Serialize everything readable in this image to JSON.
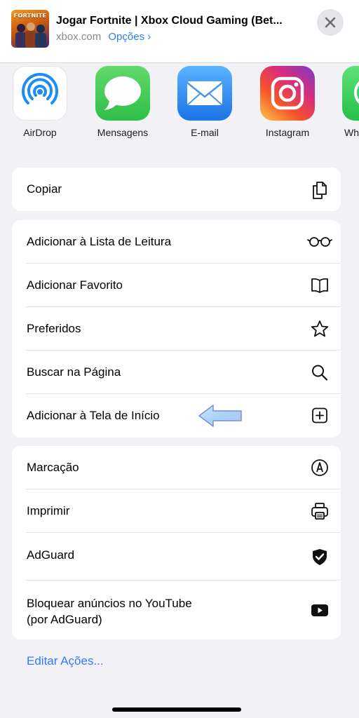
{
  "header": {
    "thumbnail_text": "FORTNITE",
    "title": "Jogar Fortnite | Xbox Cloud Gaming (Bet...",
    "domain": "xbox.com",
    "options_label": "Opções",
    "options_chevron": "›",
    "close_icon": "close-icon"
  },
  "apps": [
    {
      "label": "AirDrop",
      "icon": "airdrop-icon"
    },
    {
      "label": "Mensagens",
      "icon": "messages-icon"
    },
    {
      "label": "E-mail",
      "icon": "mail-icon"
    },
    {
      "label": "Instagram",
      "icon": "instagram-icon"
    },
    {
      "label": "Wh",
      "icon": "whatsapp-icon"
    }
  ],
  "groups": {
    "copy": [
      {
        "label": "Copiar",
        "icon": "copy-icon"
      }
    ],
    "page": [
      {
        "label": "Adicionar à Lista de Leitura",
        "icon": "glasses-icon"
      },
      {
        "label": "Adicionar Favorito",
        "icon": "book-icon"
      },
      {
        "label": "Preferidos",
        "icon": "star-icon"
      },
      {
        "label": "Buscar na Página",
        "icon": "search-icon"
      },
      {
        "label": "Adicionar à Tela de Início",
        "icon": "add-square-icon"
      }
    ],
    "extras": [
      {
        "label": "Marcação",
        "icon": "markup-icon"
      },
      {
        "label": "Imprimir",
        "icon": "printer-icon"
      },
      {
        "label": "AdGuard",
        "icon": "shield-check-icon"
      },
      {
        "label_line1": "Bloquear anúncios no YouTube",
        "label_line2": "(por AdGuard)",
        "icon": "youtube-icon"
      }
    ]
  },
  "edit_actions_label": "Editar Ações...",
  "colors": {
    "accent": "#2f7cf6",
    "sheet_background": "#f2f2f6",
    "messages_green": "#34c759",
    "mail_blue": "#1e8cf5",
    "arrow_highlight": "#a9d4f5"
  }
}
